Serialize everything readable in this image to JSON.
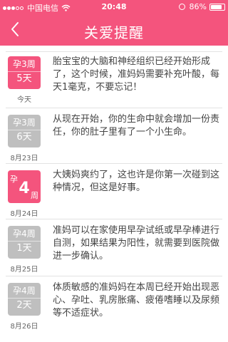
{
  "status_bar": {
    "carrier": "中国电信",
    "time": "20:48",
    "battery": "86%",
    "battery_level": 0.86,
    "signal_bars": 5,
    "signal_bars_filled": 3
  },
  "nav": {
    "title": "关爱提醒",
    "back_icon": "chevron-left-icon",
    "color": "#f4547d"
  },
  "items": [
    {
      "style": "small",
      "highlight": true,
      "week": "孕3周",
      "day": "5天",
      "date": "今天",
      "text": "胎宝宝的大脑和神经组织已经开始形成了，这个时候，准妈妈需要补充叶酸，每天1毫克，不要忘记！"
    },
    {
      "style": "small",
      "highlight": false,
      "week": "孕3周",
      "day": "6天",
      "date": "8月23日",
      "text": "从现在开始，你的生命中就会增加一份责任，你的肚子里有了一个小生命。"
    },
    {
      "style": "big",
      "highlight": true,
      "prefix": "孕",
      "number": "4",
      "suffix": "周",
      "date": "8月24日",
      "text": "大姨妈爽约了，这也许是你第一次碰到这种情况，但这是好事。"
    },
    {
      "style": "small",
      "highlight": false,
      "week": "孕4周",
      "day": "1天",
      "date": "8月25日",
      "text": "准妈可以在家使用早孕试纸或早孕棒进行自测，如果结果为阳性，就需要到医院做进一步确认。"
    },
    {
      "style": "small",
      "highlight": false,
      "week": "孕4周",
      "day": "2天",
      "date": "8月26日",
      "text": "体质敏感的准妈妈在本周已经开始出现恶心、孕吐、乳房胀痛、疲倦嗜睡以及尿频等不适症状。"
    }
  ],
  "colors": {
    "accent": "#f4547d",
    "badge_gray": "#bfbfbf",
    "text": "#444444",
    "date": "#666666"
  }
}
